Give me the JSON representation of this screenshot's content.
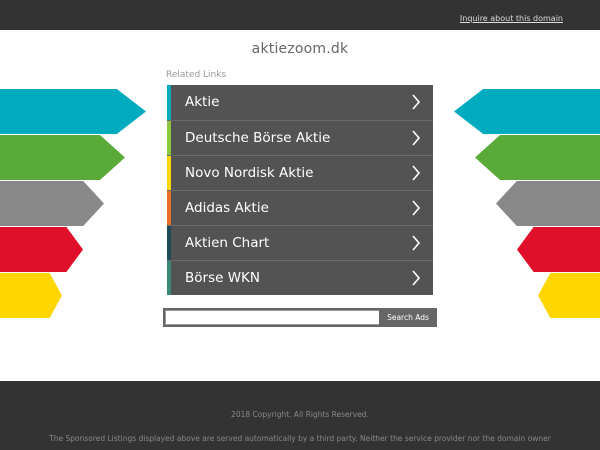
{
  "topbar": {
    "inquire_link": "Inquire about this domain"
  },
  "page": {
    "domain_title": "aktiezoom.dk",
    "related_heading": "Related Links"
  },
  "colors": {
    "teal": "#00aabf",
    "green": "#5aaa3a",
    "gray": "#888888",
    "red": "#e0102a",
    "yellow": "#ffd600",
    "orange": "#e7702a",
    "dark_teal": "#1e4b5a",
    "item_bg": "#535353"
  },
  "related_links": [
    {
      "label": "Aktie",
      "accent": "#00aabf",
      "icon": "chevron-right-icon"
    },
    {
      "label": "Deutsche Börse Aktie",
      "accent": "#8dc63f",
      "icon": "chevron-right-icon"
    },
    {
      "label": "Novo Nordisk Aktie",
      "accent": "#ffd600",
      "icon": "chevron-right-icon"
    },
    {
      "label": "Adidas Aktie",
      "accent": "#e7702a",
      "icon": "chevron-right-icon"
    },
    {
      "label": "Aktien Chart",
      "accent": "#1e4b5a",
      "icon": "chevron-right-icon"
    },
    {
      "label": "Börse WKN",
      "accent": "#3a8a7a",
      "icon": "chevron-right-icon"
    }
  ],
  "search": {
    "placeholder": "",
    "button_label": "Search Ads"
  },
  "footer": {
    "copyright": "2018 Copyright. All Rights Reserved.",
    "disclaimer": "The Sponsored Listings displayed above are served automatically by a third party. Neither the service provider nor the domain owner"
  }
}
